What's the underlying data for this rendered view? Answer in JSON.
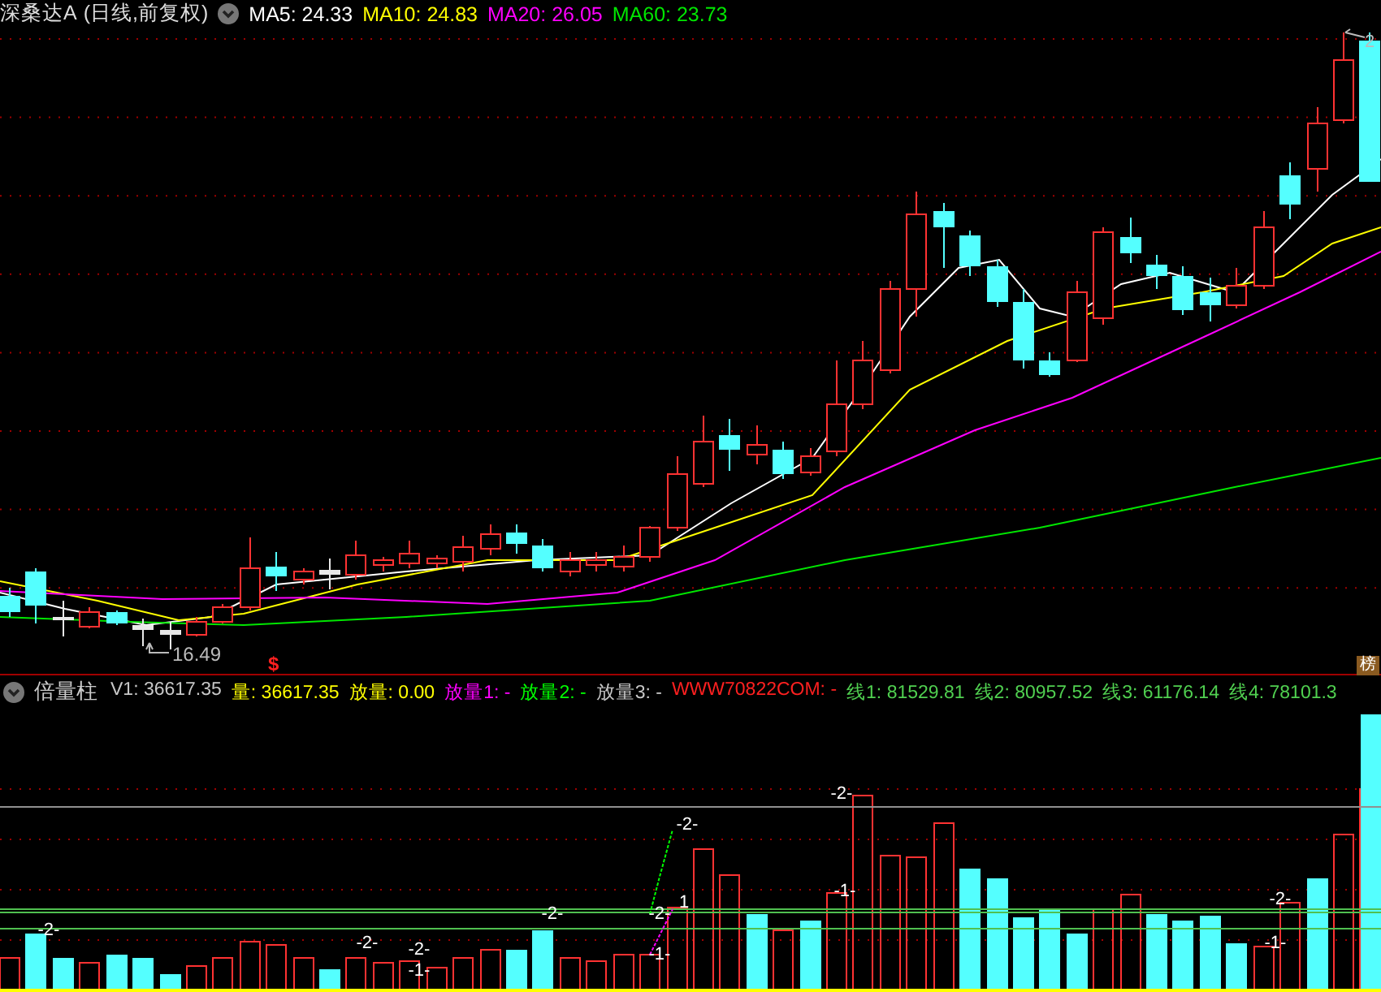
{
  "main_chart": {
    "title": "深桑达A",
    "period": "(日线,前复权)",
    "ma_legend": [
      {
        "label": "MA5: 24.33",
        "color": "#ffffff"
      },
      {
        "label": "MA10: 24.83",
        "color": "#ffff00"
      },
      {
        "label": "MA20: 26.05",
        "color": "#ff00ff"
      },
      {
        "label": "MA60: 23.73",
        "color": "#00e600"
      }
    ],
    "low_label": "16.49",
    "high_label": "2",
    "signal_mark": "$",
    "badge": "榜"
  },
  "volume_panel": {
    "title": "倍量柱",
    "legend": [
      {
        "label": "V1: 36617.35",
        "color": "#c8c8c8"
      },
      {
        "label": "量: 36617.35",
        "color": "#ffff00"
      },
      {
        "label": "放量: 0.00",
        "color": "#ffff00"
      },
      {
        "label": "放量1: -",
        "color": "#ff00ff"
      },
      {
        "label": "放量2: -",
        "color": "#00ff00"
      },
      {
        "label": "放量3: -",
        "color": "#c8c8c8"
      },
      {
        "label": "WWW70822COM: -",
        "color": "#ff2020"
      },
      {
        "label": "线1: 81529.81",
        "color": "#50d050"
      },
      {
        "label": "线2: 80957.52",
        "color": "#50d050"
      },
      {
        "label": "线3: 61176.14",
        "color": "#50d050"
      },
      {
        "label": "线4: 78101.3",
        "color": "#50d050"
      }
    ],
    "markers": [
      "-2-",
      "-2-",
      "-2-",
      "-2-",
      "-1-",
      "-2-",
      "-2-",
      "-1-",
      "-2-",
      "1",
      "-1-",
      "-2-",
      "-1-"
    ]
  }
}
